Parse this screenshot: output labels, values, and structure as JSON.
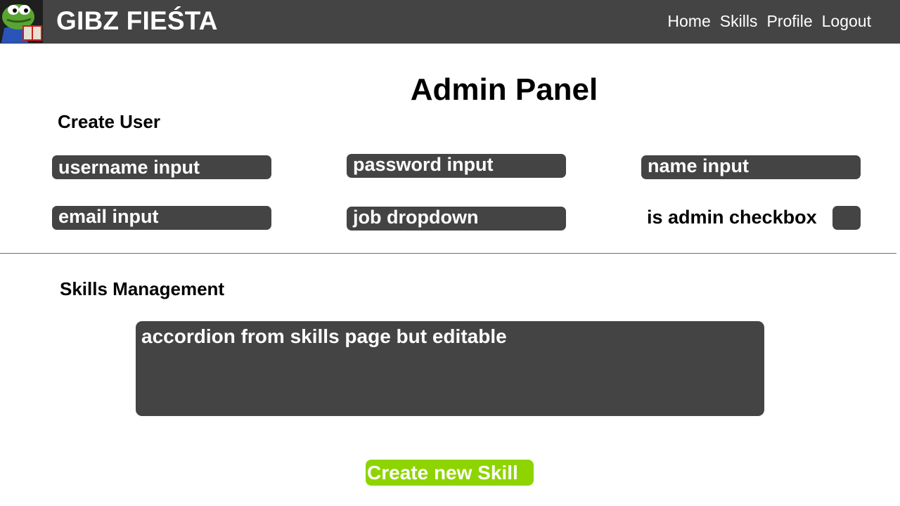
{
  "header": {
    "logo_alt": "frog avatar",
    "brand": "GIBZ FIEŚTA",
    "nav": [
      "Home",
      "Skills",
      "Profile",
      "Logout"
    ]
  },
  "main": {
    "title": "Admin Panel",
    "create_user": {
      "heading": "Create User",
      "username_placeholder": "username input",
      "password_placeholder": "password input",
      "name_placeholder": "name input",
      "email_placeholder": "email input",
      "job_dropdown": "job dropdown",
      "is_admin_label": "is admin checkbox"
    },
    "skills": {
      "heading": "Skills Management",
      "accordion_text": "accordion from skills page but editable",
      "create_button": "Create new Skill"
    }
  },
  "colors": {
    "header_bg": "#444444",
    "field_bg": "#444444",
    "accent_green": "#8dd400"
  }
}
